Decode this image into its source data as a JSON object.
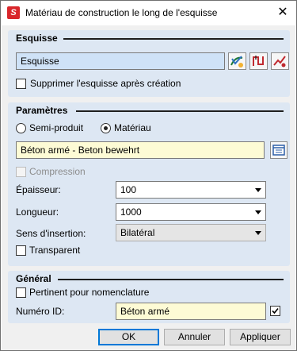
{
  "window": {
    "title": "Matériau de construction le long de l'esquisse",
    "app_icon_glyph": "S",
    "close_glyph": "✕"
  },
  "esquisse": {
    "title": "Esquisse",
    "field_value": "Esquisse",
    "delete_after_label": "Supprimer l'esquisse après création",
    "delete_after_checked": false
  },
  "parametres": {
    "title": "Paramètres",
    "radio_semi_label": "Semi-produit",
    "radio_materiau_label": "Matériau",
    "selected": "Matériau",
    "material_value": "Béton armé - Beton bewehrt",
    "compression_label": "Compression",
    "compression_enabled": false,
    "epaisseur_label": "Épaisseur:",
    "epaisseur_value": "100",
    "longueur_label": "Longueur:",
    "longueur_value": "1000",
    "sens_label": "Sens d'insertion:",
    "sens_value": "Bilatéral",
    "transparent_label": "Transparent",
    "transparent_checked": false
  },
  "general": {
    "title": "Général",
    "pertinent_label": "Pertinent pour nomenclature",
    "pertinent_checked": false,
    "numero_label": "Numéro ID:",
    "numero_value": "Béton armé",
    "numero_checked": true
  },
  "buttons": {
    "ok": "OK",
    "annuler": "Annuler",
    "appliquer": "Appliquer"
  },
  "colors": {
    "section_bg": "#dde7f3",
    "field_blue": "#cfe2f7",
    "field_yellow": "#fdfbd5",
    "default_button_border": "#0078d7"
  }
}
